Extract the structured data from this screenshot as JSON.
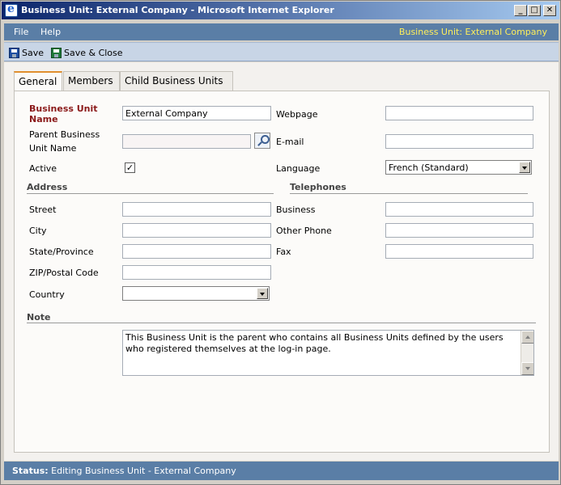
{
  "window": {
    "title": "Business Unit: External Company - Microsoft Internet Explorer",
    "min_symbol": "_",
    "max_symbol": "□",
    "close_symbol": "✕"
  },
  "menu": {
    "file": "File",
    "help": "Help",
    "context": "Business Unit: External Company"
  },
  "toolbar": {
    "save": "Save",
    "save_close": "Save & Close"
  },
  "tabs": [
    "General",
    "Members",
    "Child Business Units"
  ],
  "form": {
    "name_label_1": "Business Unit",
    "name_label_2": "Name",
    "name_value": "External Company",
    "parent_label_1": "Parent Business",
    "parent_label_2": "Unit Name",
    "parent_value": "",
    "active_label": "Active",
    "active_mark": "✓",
    "webpage_label": "Webpage",
    "email_label": "E-mail",
    "language_label": "Language",
    "language_value": "French (Standard)"
  },
  "address": {
    "section": "Address",
    "street": "Street",
    "city": "City",
    "state": "State/Province",
    "zip": "ZIP/Postal Code",
    "country": "Country"
  },
  "telephones": {
    "section": "Telephones",
    "business": "Business",
    "other": "Other Phone",
    "fax": "Fax"
  },
  "note": {
    "section": "Note",
    "text": "This Business Unit is the parent who contains all Business Units defined by the users who registered themselves at the log-in page."
  },
  "status": {
    "label": "Status:",
    "text": "Editing Business Unit - External Company"
  }
}
